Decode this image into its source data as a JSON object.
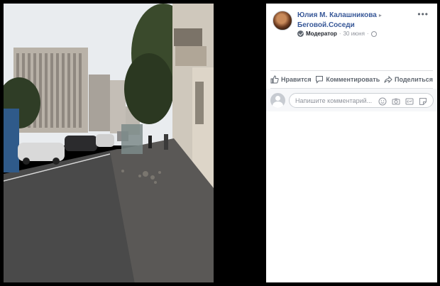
{
  "post": {
    "author": "Юлия М. Калашникова",
    "separator": "▸",
    "group": "Беговой.Соседи",
    "role": "Модератор",
    "dot": "·",
    "date": "30 июня",
    "more": "•••"
  },
  "actions": {
    "like": "Нравится",
    "comment": "Комментировать",
    "share": "Поделиться"
  },
  "comment_box": {
    "placeholder": "Напишите комментарий...",
    "icons": [
      "smile-icon",
      "camera-icon",
      "gif-icon",
      "sticker-icon"
    ]
  },
  "colors": {
    "link": "#385898",
    "muted": "#90949c",
    "background": "#000000"
  }
}
